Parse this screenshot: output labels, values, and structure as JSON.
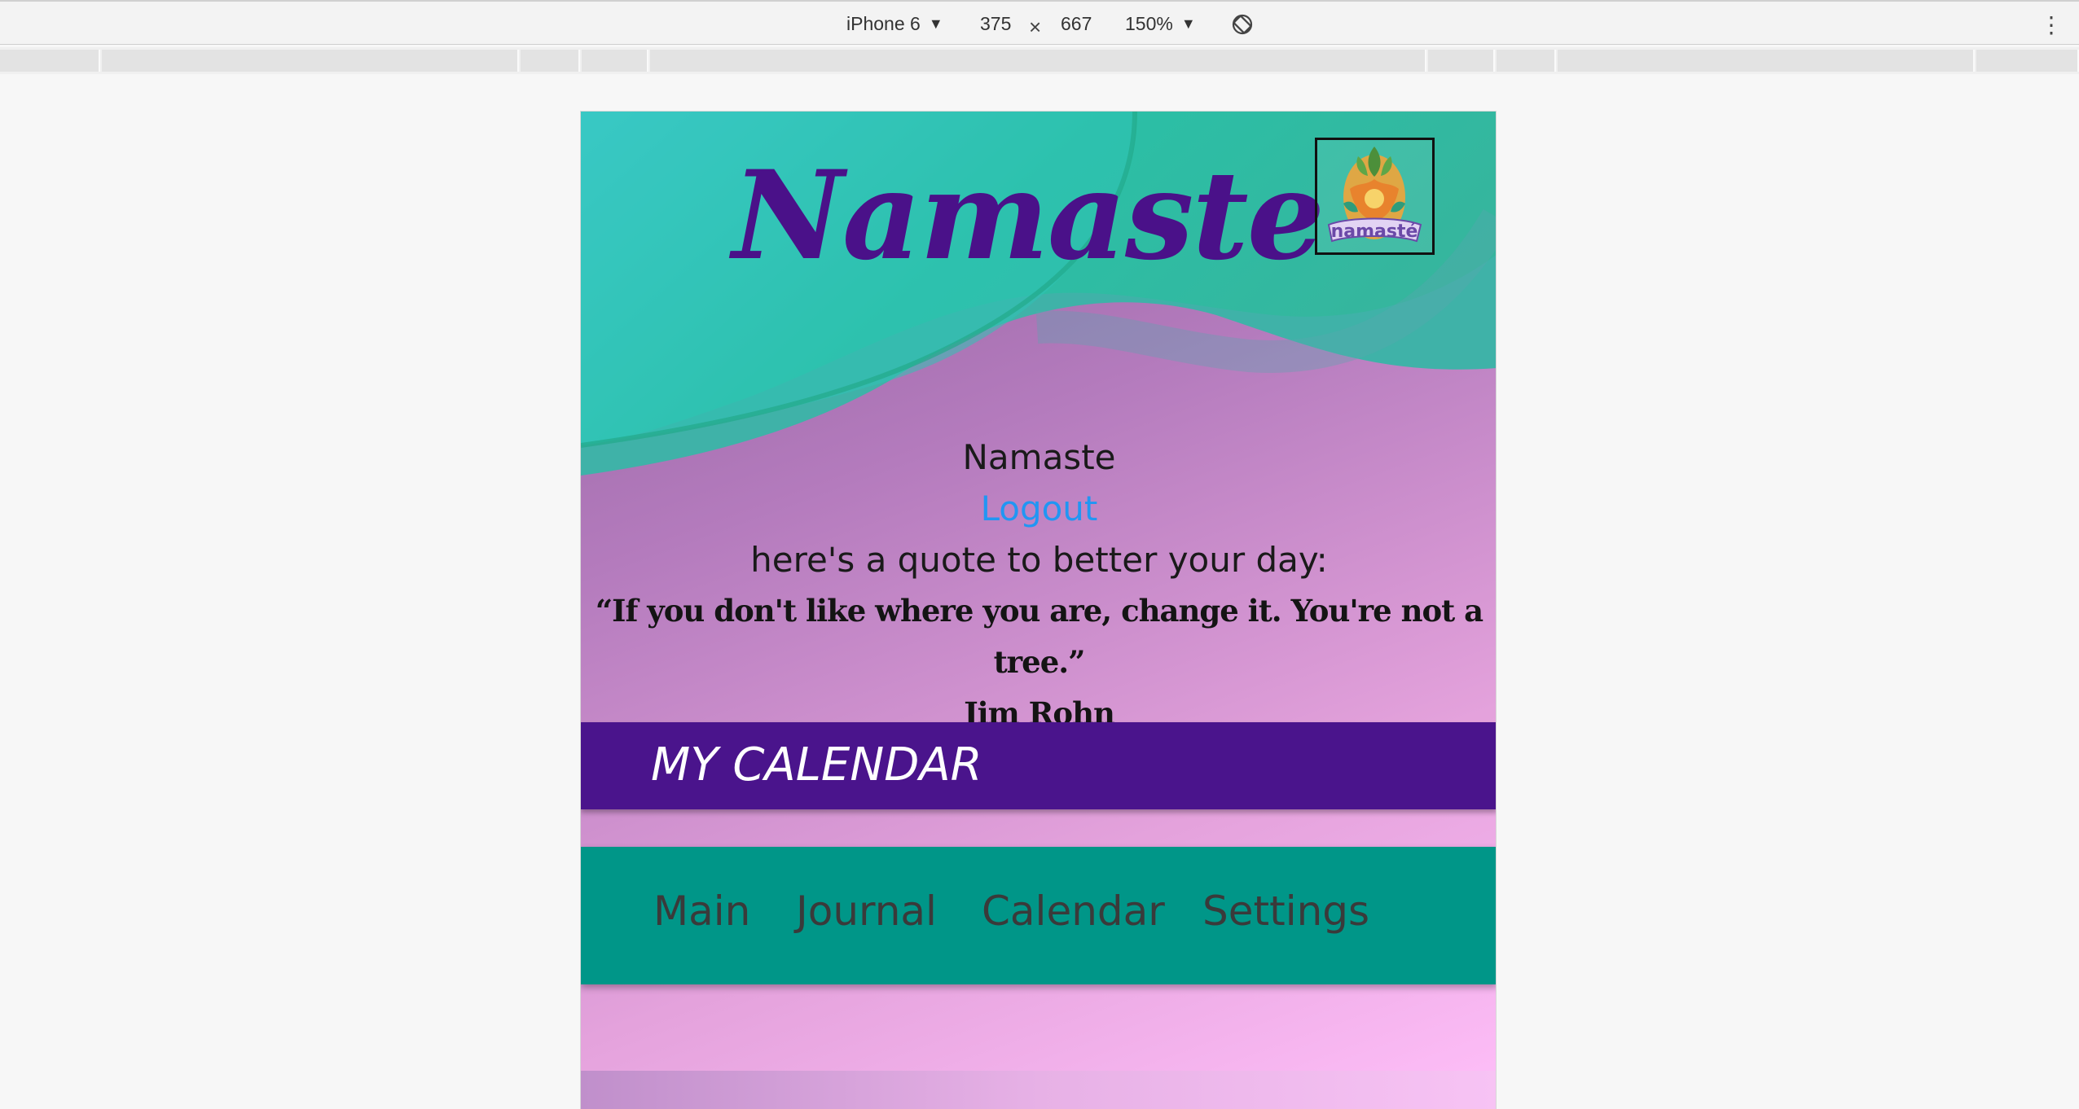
{
  "devtools": {
    "device": "iPhone 6",
    "width": "375",
    "height": "667",
    "zoom": "150%",
    "caret": "▼",
    "times": "×",
    "more": "⋮"
  },
  "site": {
    "title": "Namaste",
    "logo_text": "namasté"
  },
  "greeting": {
    "name_line": "Namaste",
    "logout": "Logout",
    "intro": "here's a quote to better your day:",
    "quote": "“If you don't like where you are, change it. You're not a tree.”",
    "author": "Jim Rohn"
  },
  "section": {
    "title": "MY CALENDAR"
  },
  "nav": {
    "items": [
      {
        "label": "Main"
      },
      {
        "label": "Journal"
      },
      {
        "label": "Calendar"
      },
      {
        "label": "Settings"
      }
    ]
  },
  "colors": {
    "title_purple": "#4a1189",
    "calendar_bar": "#4a148c",
    "nav_teal": "#009688",
    "link_blue": "#2196f3",
    "header_teal": "#2bbfa6"
  },
  "icons": [
    "chevron-down-icon",
    "times-icon",
    "rotate-icon",
    "more-vert-icon",
    "namaste-logo"
  ]
}
